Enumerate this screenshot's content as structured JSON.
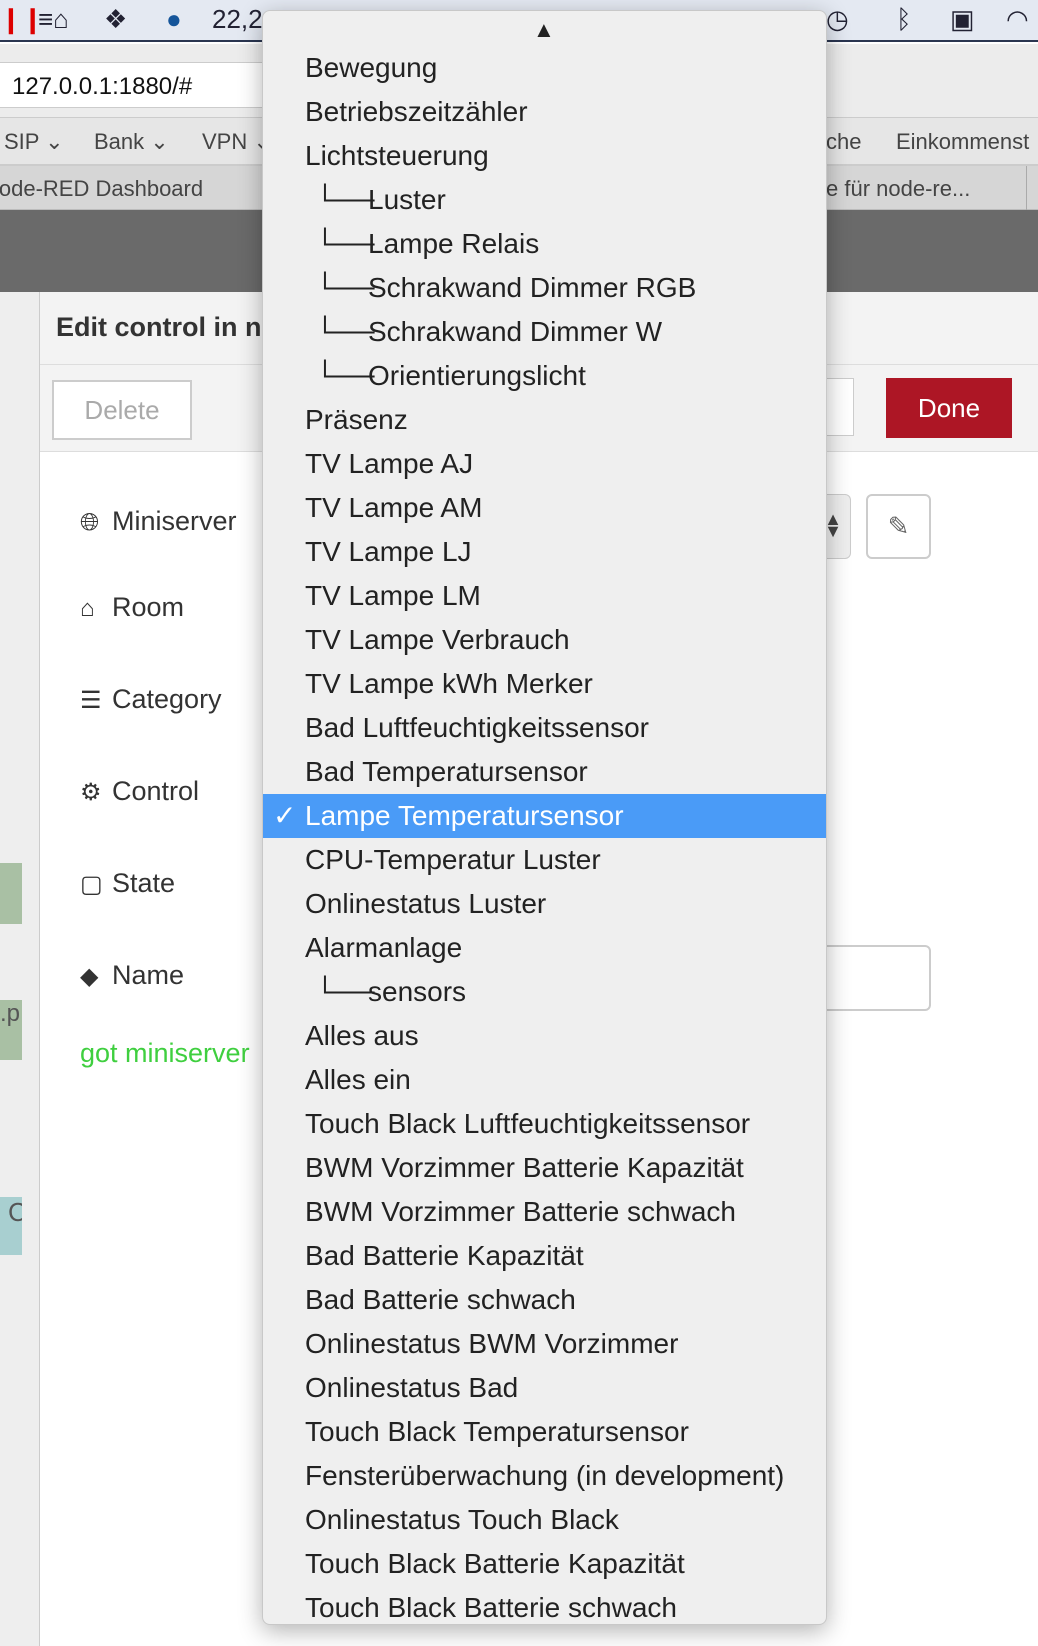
{
  "menubar": {
    "battery_text": "22,2"
  },
  "browser": {
    "url": "127.0.0.1:1880/#",
    "bookmarks": [
      "SIP",
      "Bank",
      "VPN",
      "che",
      "Einkommenst"
    ],
    "tabs": [
      "lode-RED Dashboard",
      "e für node-re..."
    ]
  },
  "editor": {
    "title": "Edit control in n",
    "delete_label": "Delete",
    "done_label": "Done",
    "fields": [
      {
        "icon": "globe-icon",
        "label": "Miniserver"
      },
      {
        "icon": "home-icon",
        "label": "Room"
      },
      {
        "icon": "list-icon",
        "label": "Category"
      },
      {
        "icon": "gears-icon",
        "label": "Control"
      },
      {
        "icon": "file-icon",
        "label": "State"
      },
      {
        "icon": "tag-icon",
        "label": "Name"
      }
    ],
    "status": "got miniserver",
    "status_color": "#3fcf3f"
  },
  "canvas": {
    "fragments": [
      ".p",
      "C"
    ]
  },
  "dropdown": {
    "selected_index": 17,
    "options": [
      {
        "label": "Bewegung",
        "child": false
      },
      {
        "label": "Betriebszeitzähler",
        "child": false
      },
      {
        "label": "Lichtsteuerung",
        "child": false
      },
      {
        "label": "Luster",
        "child": true
      },
      {
        "label": "Lampe Relais",
        "child": true
      },
      {
        "label": "Schrakwand Dimmer RGB",
        "child": true
      },
      {
        "label": "Schrakwand Dimmer W",
        "child": true
      },
      {
        "label": "Orientierungslicht",
        "child": true
      },
      {
        "label": "Präsenz",
        "child": false
      },
      {
        "label": "TV Lampe AJ",
        "child": false
      },
      {
        "label": "TV Lampe AM",
        "child": false
      },
      {
        "label": "TV Lampe LJ",
        "child": false
      },
      {
        "label": "TV Lampe LM",
        "child": false
      },
      {
        "label": "TV Lampe Verbrauch",
        "child": false
      },
      {
        "label": "TV Lampe kWh Merker",
        "child": false
      },
      {
        "label": "Bad Luftfeuchtigkeitssensor",
        "child": false
      },
      {
        "label": "Bad Temperatursensor",
        "child": false
      },
      {
        "label": "Lampe Temperatursensor",
        "child": false
      },
      {
        "label": "CPU-Temperatur Luster",
        "child": false
      },
      {
        "label": "Onlinestatus Luster",
        "child": false
      },
      {
        "label": "Alarmanlage",
        "child": false
      },
      {
        "label": "sensors",
        "child": true
      },
      {
        "label": "Alles aus",
        "child": false
      },
      {
        "label": "Alles ein",
        "child": false
      },
      {
        "label": "Touch Black Luftfeuchtigkeitssensor",
        "child": false
      },
      {
        "label": "BWM Vorzimmer Batterie Kapazität",
        "child": false
      },
      {
        "label": "BWM Vorzimmer Batterie schwach",
        "child": false
      },
      {
        "label": "Bad Batterie Kapazität",
        "child": false
      },
      {
        "label": "Bad Batterie schwach",
        "child": false
      },
      {
        "label": "Onlinestatus BWM Vorzimmer",
        "child": false
      },
      {
        "label": "Onlinestatus Bad",
        "child": false
      },
      {
        "label": "Touch Black Temperatursensor",
        "child": false
      },
      {
        "label": "Fensterüberwachung (in development)",
        "child": false
      },
      {
        "label": "Onlinestatus Touch Black",
        "child": false
      },
      {
        "label": "Touch Black Batterie Kapazität",
        "child": false
      },
      {
        "label": "Touch Black Batterie schwach",
        "child": false
      }
    ],
    "highlight_color": "#4a9bf7"
  }
}
